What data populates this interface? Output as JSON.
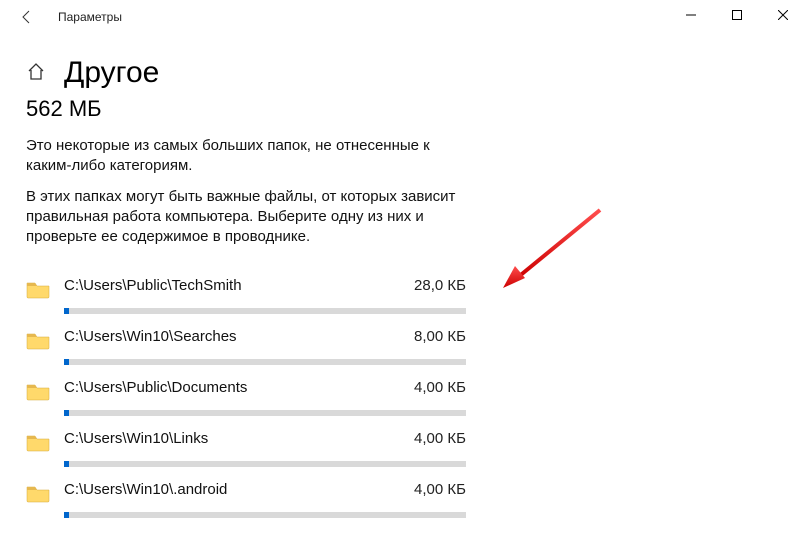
{
  "window": {
    "title": "Параметры"
  },
  "page": {
    "title": "Другое",
    "total": "562 МБ",
    "description1": "Это некоторые из самых больших папок, не отнесенные к каким-либо категориям.",
    "description2": "В этих папках могут быть важные файлы, от которых зависит правильная работа компьютера. Выберите одну из них и проверьте ее содержимое в проводнике."
  },
  "folders": [
    {
      "path": "C:\\Users\\Public\\TechSmith",
      "size": "28,0 КБ",
      "fill_pct": 1.2
    },
    {
      "path": "C:\\Users\\Win10\\Searches",
      "size": "8,00 КБ",
      "fill_pct": 1.2
    },
    {
      "path": "C:\\Users\\Public\\Documents",
      "size": "4,00 КБ",
      "fill_pct": 1.2
    },
    {
      "path": "C:\\Users\\Win10\\Links",
      "size": "4,00 КБ",
      "fill_pct": 1.2
    },
    {
      "path": "C:\\Users\\Win10\\.android",
      "size": "4,00 КБ",
      "fill_pct": 1.2
    }
  ]
}
